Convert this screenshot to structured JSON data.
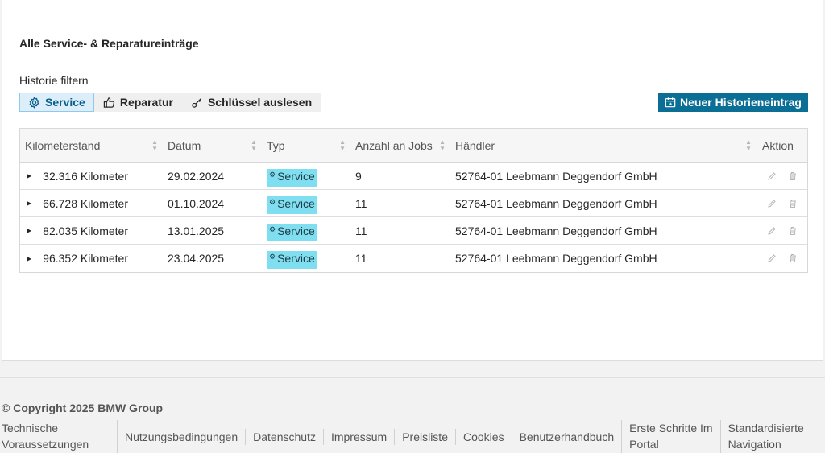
{
  "section": {
    "title": "Alle Service- & Reparatureinträge"
  },
  "filter": {
    "label": "Historie filtern",
    "buttons": [
      {
        "label": "Service",
        "icon": "gear-icon",
        "active": true
      },
      {
        "label": "Reparatur",
        "icon": "thumbs-up-icon",
        "active": false
      },
      {
        "label": "Schlüssel auslesen",
        "icon": "key-icon",
        "active": false
      }
    ]
  },
  "new_entry": {
    "label": "Neuer Historieneintrag",
    "icon": "calendar-plus-icon"
  },
  "table": {
    "columns": [
      "Kilometerstand",
      "Datum",
      "Typ",
      "Anzahl an Jobs",
      "Händler",
      "Aktion"
    ],
    "rows": [
      {
        "km": "32.316 Kilometer",
        "date": "29.02.2024",
        "type": "Service",
        "jobs": "9",
        "dealer": "52764-01 Leebmann Deggendorf GmbH"
      },
      {
        "km": "66.728 Kilometer",
        "date": "01.10.2024",
        "type": "Service",
        "jobs": "11",
        "dealer": "52764-01 Leebmann Deggendorf GmbH"
      },
      {
        "km": "82.035 Kilometer",
        "date": "13.01.2025",
        "type": "Service",
        "jobs": "11",
        "dealer": "52764-01 Leebmann Deggendorf GmbH"
      },
      {
        "km": "96.352 Kilometer",
        "date": "23.04.2025",
        "type": "Service",
        "jobs": "11",
        "dealer": "52764-01 Leebmann Deggendorf GmbH"
      }
    ]
  },
  "footer": {
    "copyright": "© Copyright 2025 BMW Group",
    "links": {
      "tech_line1": "Technische",
      "tech_line2": "Voraussetzungen",
      "nutzung": "Nutzungsbedingungen",
      "datenschutz": "Datenschutz",
      "impressum": "Impressum",
      "preisliste": "Preisliste",
      "cookies": "Cookies",
      "handbuch": "Benutzerhandbuch",
      "erste_line1": "Erste Schritte Im",
      "erste_line2": "Portal",
      "std_line1": "Standardisierte",
      "std_line2": "Navigation"
    }
  },
  "colors": {
    "primary": "#0b6e95",
    "badge": "#7fdef0",
    "active_filter_bg": "#dbeefa"
  }
}
